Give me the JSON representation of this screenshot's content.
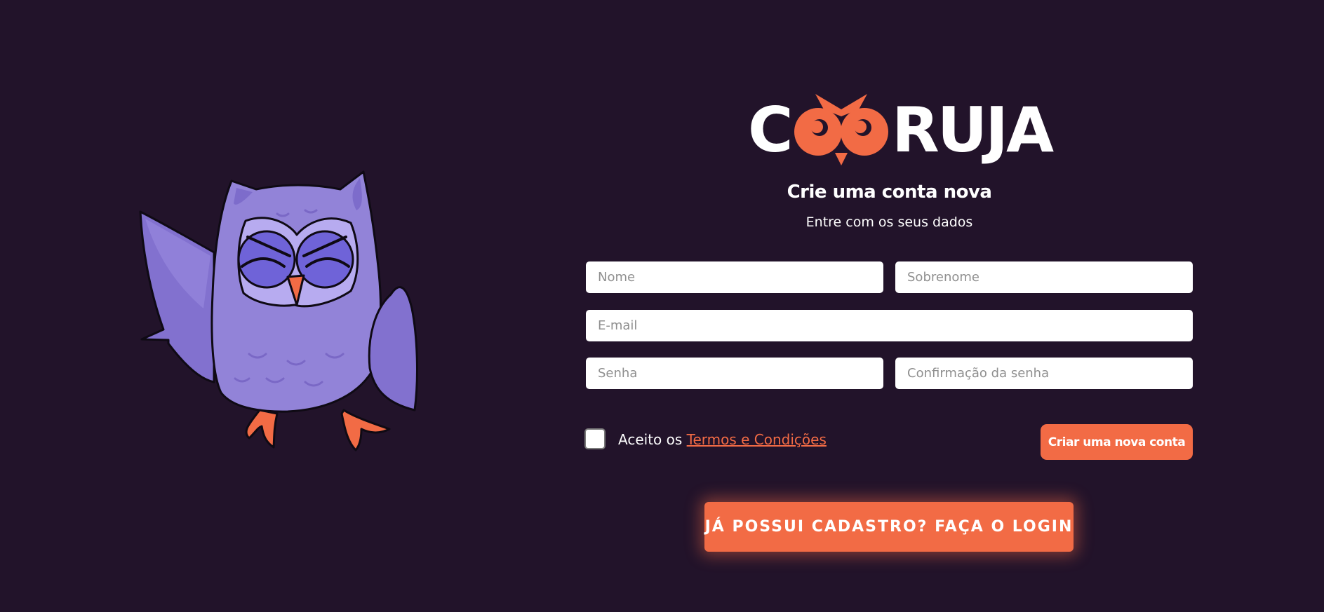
{
  "brand": {
    "logo_left": "C",
    "logo_right": "RUJA",
    "accent": "#f26b45",
    "background": "#22132a",
    "owl_body": "#9283d8"
  },
  "form": {
    "title": "Crie uma conta nova",
    "subtitle": "Entre com os seus dados",
    "fields": {
      "first_name_placeholder": "Nome",
      "last_name_placeholder": "Sobrenome",
      "email_placeholder": "E-mail",
      "password_placeholder": "Senha",
      "password_confirm_placeholder": "Confirmação da senha"
    },
    "terms": {
      "prefix": "Aceito os ",
      "link": "Termos e Condições",
      "checked": false
    },
    "submit_label": "Criar uma nova conta"
  },
  "login_cta": "JÁ POSSUI CADASTRO? FAÇA O LOGIN"
}
